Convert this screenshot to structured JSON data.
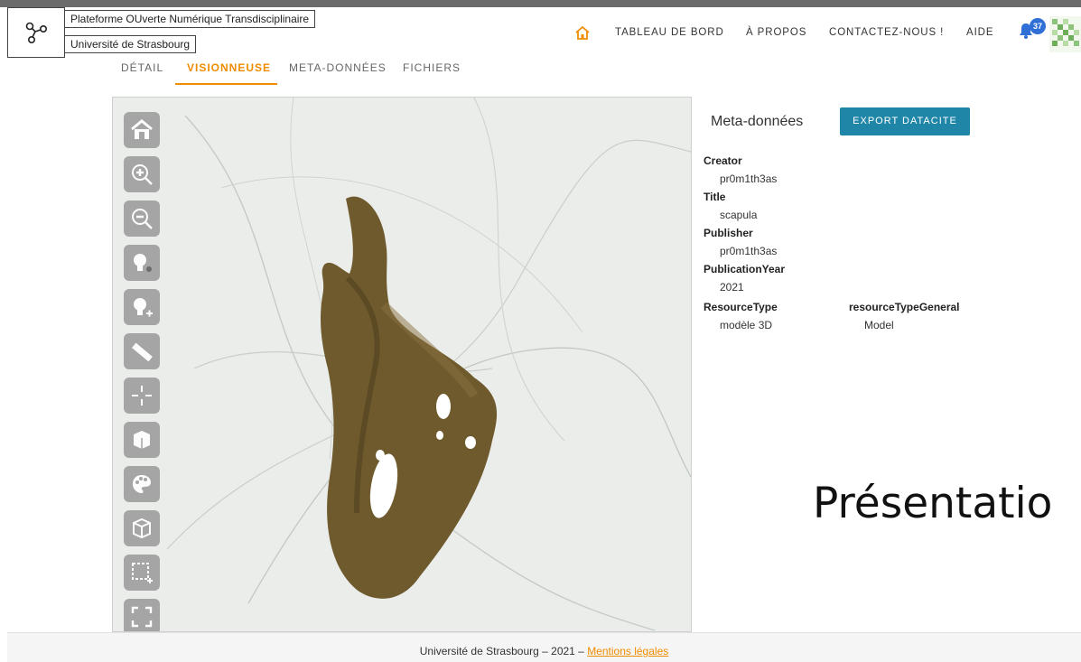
{
  "header": {
    "site_title": "Plateforme OUverte Numérique Transdisciplinaire",
    "site_subtitle": "Université de Strasbourg",
    "logo_icon": "network-logo-icon",
    "nav": {
      "home_icon": "home-icon",
      "dashboard": "TABLEAU DE BORD",
      "about": "À PROPOS",
      "contact": "CONTACTEZ-NOUS !",
      "help": "AIDE"
    },
    "notifications": {
      "icon": "bell-icon",
      "count": "37"
    },
    "avatar_icon": "avatar-icon"
  },
  "tabs": [
    "DÉTAIL",
    "VISIONNEUSE",
    "META-DONNÉES",
    "FICHIERS"
  ],
  "active_tab": "VISIONNEUSE",
  "viewer": {
    "tools": [
      "home-icon",
      "zoom-in-icon",
      "zoom-out-icon",
      "light-icon",
      "light-add-icon",
      "ruler-icon",
      "crosshair-icon",
      "cube-icon",
      "palette-icon",
      "wireframe-cube-icon",
      "selection-icon",
      "fullscreen-icon"
    ]
  },
  "metadata": {
    "heading": "Meta-données",
    "export_button": "EXPORT DATACITE",
    "creator_label": "Creator",
    "creator": "pr0m1th3as",
    "title_label": "Title",
    "title": "scapula",
    "publisher_label": "Publisher",
    "publisher": "pr0m1th3as",
    "year_label": "PublicationYear",
    "year": "2021",
    "resource_type_label": "ResourceType",
    "resource_type": "modèle 3D",
    "resource_general_label": "resourceTypeGeneral",
    "resource_general": "Model"
  },
  "presentation_heading": "Présentatio",
  "footer": {
    "text": "Université de Strasbourg – 2021 – ",
    "link": "Mentions légales"
  },
  "colors": {
    "accent": "#f08c00",
    "button": "#1f86a7",
    "badge": "#2f6fd6"
  }
}
